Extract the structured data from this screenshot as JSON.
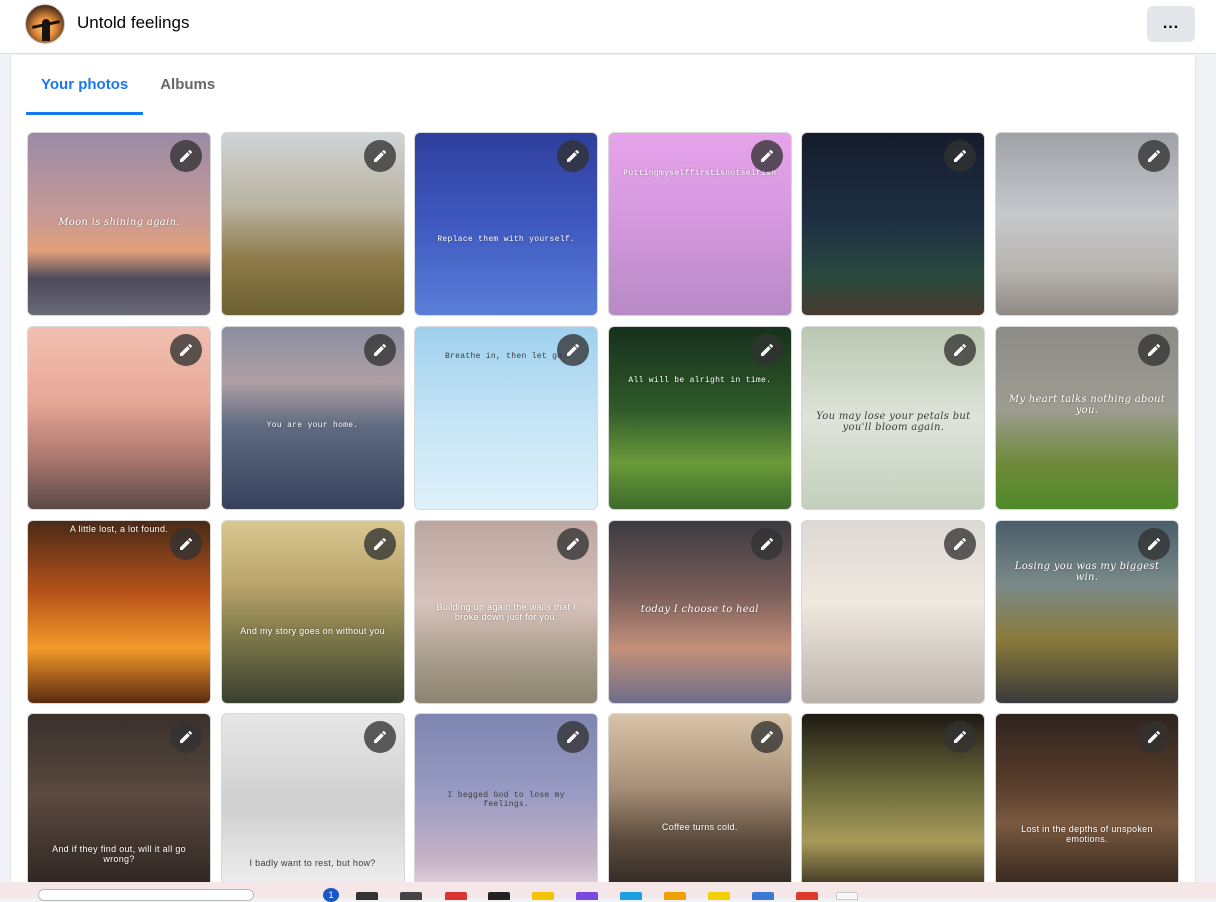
{
  "header": {
    "title": "Untold feelings",
    "more_label": "..."
  },
  "tabs": [
    {
      "label": "Your photos",
      "active": true
    },
    {
      "label": "Albums",
      "active": false
    }
  ],
  "photos": [
    {
      "caption": "Moon is shining again.",
      "bg": "linear-gradient(180deg,#9a8aa6 0%,#c79a96 45%,#e2a07a 65%,#4d4a5a 80%,#6b6a78 100%)",
      "style": "script",
      "pos": 46
    },
    {
      "caption": "",
      "bg": "linear-gradient(180deg,#cfd4d6 0%,#b9b3a0 40%,#8d7a4a 70%,#6c6030 100%)",
      "style": "",
      "pos": 50
    },
    {
      "caption": "Replace them with yourself.",
      "bg": "linear-gradient(180deg,#2e3f9c 0%,#3f59c0 50%,#5a7fd8 100%)",
      "style": "mono",
      "pos": 56
    },
    {
      "caption": "Puttingmyselffirstisnotselfish",
      "bg": "linear-gradient(180deg,#e6a3ea 0%,#d89ae0 40%,#b88ac6 100%)",
      "style": "mono",
      "pos": 20
    },
    {
      "caption": "",
      "bg": "linear-gradient(180deg,#151c2c 0%,#1e3044 50%,#2b4a3e 80%,#4a3a30 100%)",
      "style": "",
      "pos": 50
    },
    {
      "caption": "",
      "bg": "linear-gradient(180deg,#9ea1a6 0%,#c6c8cc 45%,#b8b4ae 75%,#8f8a84 100%)",
      "style": "",
      "pos": 50
    },
    {
      "caption": "",
      "bg": "linear-gradient(180deg,#f1c0b0 0%,#e8a898 40%,#b07a72 70%,#5a4a48 100%)",
      "style": "",
      "pos": 50
    },
    {
      "caption": "You are your home.",
      "bg": "linear-gradient(180deg,#8a8ea0 0%,#b09fa4 30%,#5d6a80 55%,#36425c 100%)",
      "style": "mono",
      "pos": 52
    },
    {
      "caption": "Breathe in, then let go.",
      "bg": "linear-gradient(180deg,#9fd0ee 0%,#c4e4f6 50%,#dff1fa 100%)",
      "style": "mono dark",
      "pos": 14
    },
    {
      "caption": "All will be alright in time.",
      "bg": "linear-gradient(180deg,#16301c 0%,#2f5a2a 45%,#6b9a3a 75%,#3c6b2c 100%)",
      "style": "mono",
      "pos": 27
    },
    {
      "caption": "You may lose your petals but you'll bloom again.",
      "bg": "linear-gradient(180deg,#b9c7b0 0%,#dfe3da 50%,#c3cfbc 100%)",
      "style": "script dark",
      "pos": 46
    },
    {
      "caption": "My heart talks nothing about you.",
      "bg": "linear-gradient(180deg,#8c8b86 0%,#9e9c92 45%,#6e8a3a 75%,#4f8a2a 100%)",
      "style": "script",
      "pos": 37
    },
    {
      "caption": "A little lost, a lot found.",
      "bg": "linear-gradient(180deg,#4a2a18 0%,#b8541a 40%,#f39a2a 70%,#5a2a10 100%)",
      "style": "",
      "pos": 2
    },
    {
      "caption": "And my story goes on without you",
      "bg": "linear-gradient(180deg,#d8c890 0%,#b9a46a 35%,#7a7648 65%,#394030 100%)",
      "style": "",
      "pos": 58
    },
    {
      "caption": "Building up again the walls that I broke down just for you.",
      "bg": "linear-gradient(180deg,#bba7a0 0%,#d8c3bc 45%,#a99d8c 75%,#8c8470 100%)",
      "style": "",
      "pos": 45
    },
    {
      "caption": "today I choose to heal",
      "bg": "linear-gradient(180deg,#3c3a42 0%,#7a5e5a 40%,#c4907a 70%,#6e6e8a 100%)",
      "style": "script",
      "pos": 46
    },
    {
      "caption": "",
      "bg": "linear-gradient(180deg,#dcd8d4 0%,#efe8df 45%,#d3cbc3 75%,#b9b1aa 100%)",
      "style": "",
      "pos": 50
    },
    {
      "caption": "Losing you was my biggest win.",
      "bg": "linear-gradient(180deg,#4a5e6a 0%,#7a8a8a 35%,#8a7a3a 65%,#3a3a3a 100%)",
      "style": "script",
      "pos": 22
    },
    {
      "caption": "And if they find out, will it all go wrong?",
      "bg": "linear-gradient(180deg,#3a302c 0%,#5a4a40 45%,#2a221e 100%)",
      "style": "",
      "pos": 71
    },
    {
      "caption": "I badly want to rest, but how?",
      "bg": "linear-gradient(180deg,#e6e6e6 0%,#cfcfcf 50%,#f2f2f2 100%)",
      "style": "dark",
      "pos": 79
    },
    {
      "caption": "I begged God to lose my feelings.",
      "bg": "linear-gradient(180deg,#7d85b0 0%,#9a9cc4 45%,#c7b2c6 80%,#eadde6 100%)",
      "style": "mono dark",
      "pos": 42
    },
    {
      "caption": "Coffee turns cold.",
      "bg": "linear-gradient(180deg,#d8c4a8 0%,#a89078 40%,#5a4a3c 70%,#2a2420 100%)",
      "style": "",
      "pos": 59
    },
    {
      "caption": "",
      "bg": "linear-gradient(180deg,#1e1a14 0%,#6a6a3a 40%,#a89a5a 70%,#2a2218 100%)",
      "style": "",
      "pos": 50
    },
    {
      "caption": "Lost in the depths of unspoken emotions.",
      "bg": "linear-gradient(180deg,#2e241e 0%,#5a3e2c 40%,#7a5a40 60%,#2a1e18 100%)",
      "style": "",
      "pos": 60
    }
  ],
  "taskbar": {
    "badge": "1"
  }
}
